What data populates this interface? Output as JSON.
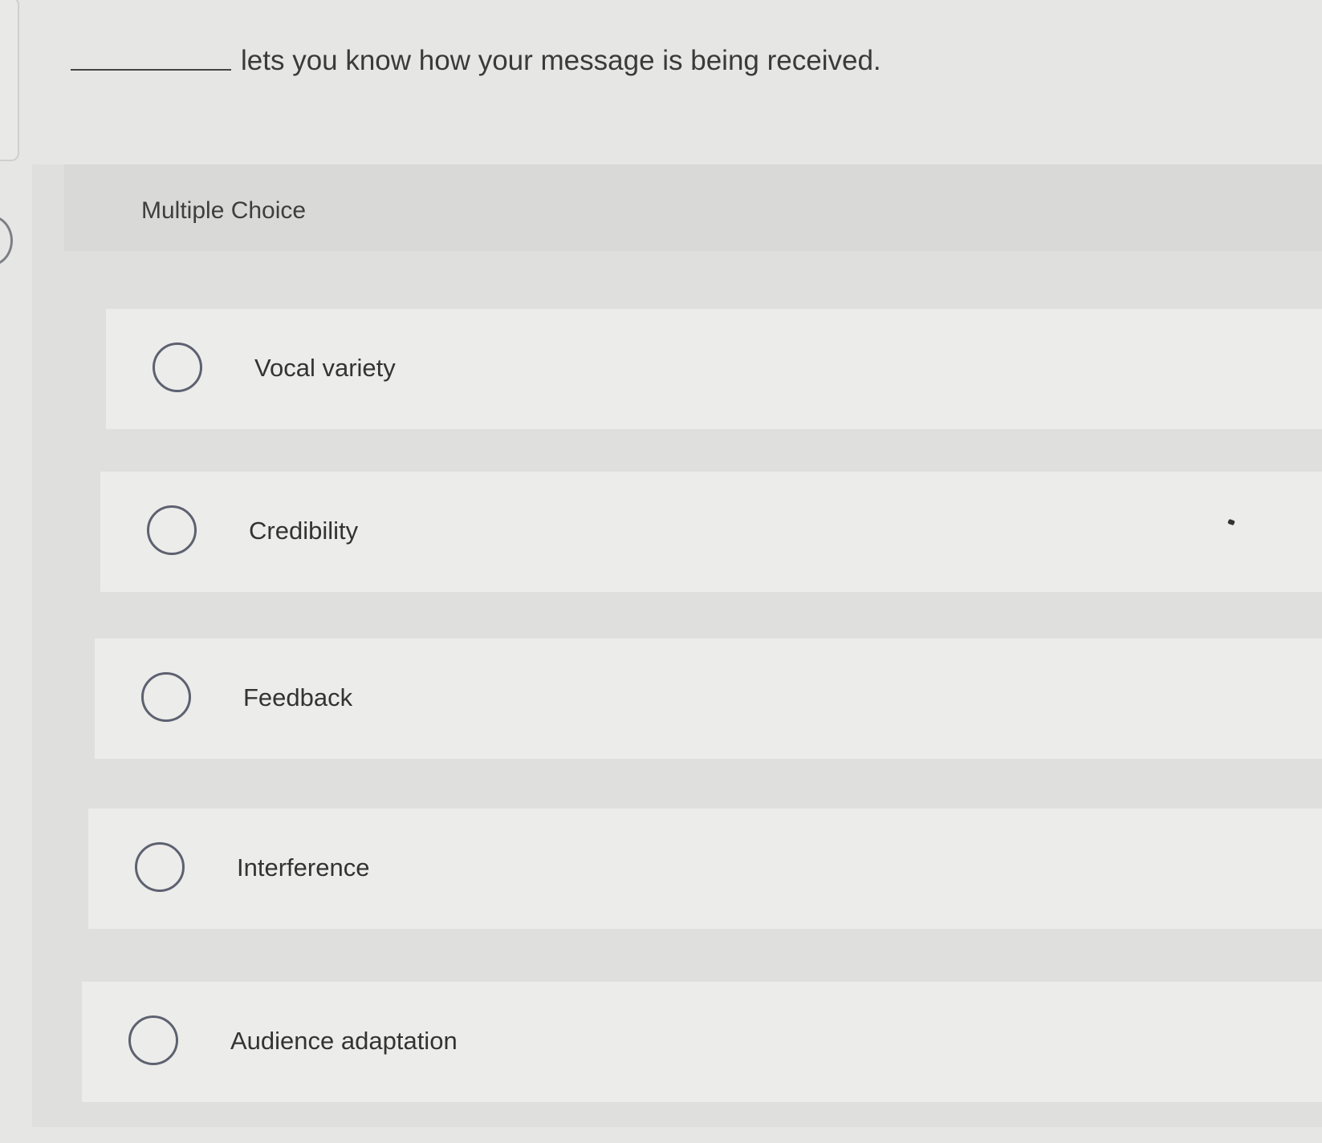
{
  "question": {
    "text": "lets you know how your message is being received."
  },
  "section_label": "Multiple Choice",
  "options": [
    {
      "label": "Vocal variety"
    },
    {
      "label": "Credibility"
    },
    {
      "label": "Feedback"
    },
    {
      "label": "Interference"
    },
    {
      "label": "Audience adaptation"
    }
  ],
  "colors": {
    "background": "#e6e6e4",
    "option_background": "#ececea",
    "radio_border": "#5d6170",
    "text": "#3a3a3a"
  }
}
